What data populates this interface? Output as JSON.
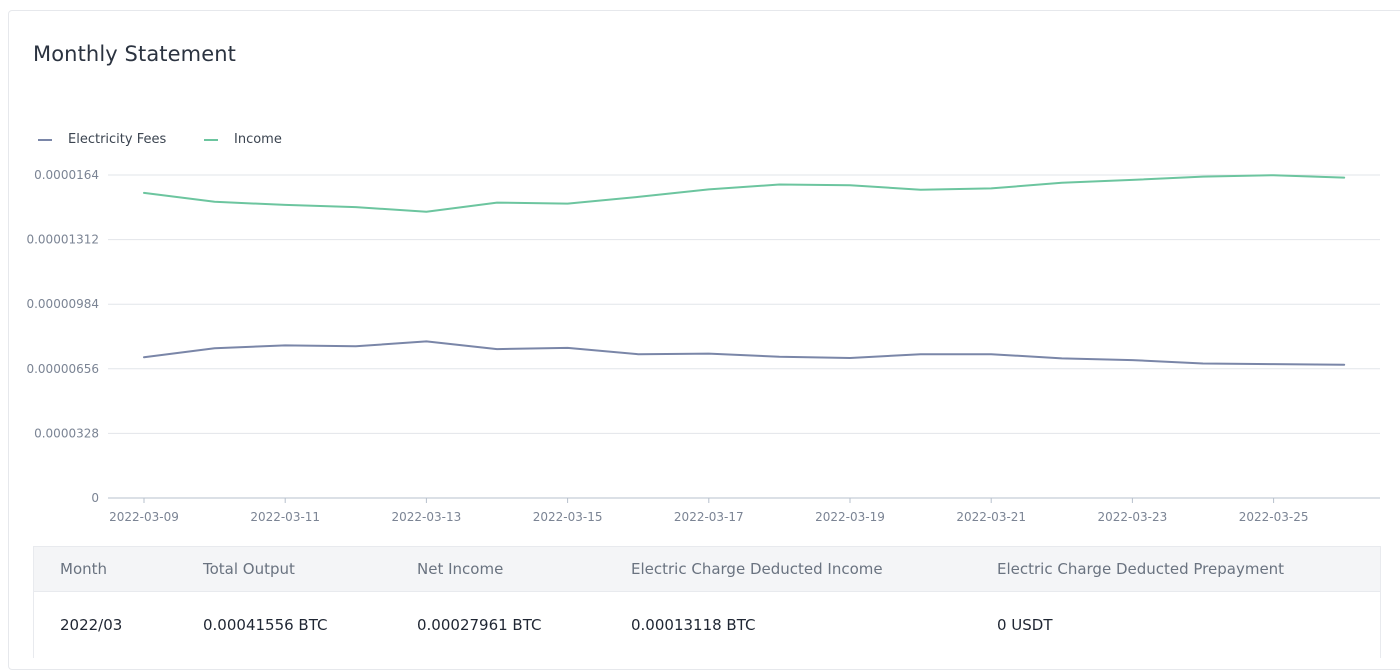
{
  "page": {
    "title": "Monthly Statement"
  },
  "colors": {
    "electricity": "#7a86a8",
    "income": "#6cc59f",
    "grid": "#e2e5ea",
    "axis": "#b7c0cc",
    "tick_text": "#7b8494"
  },
  "chart_data": {
    "type": "line",
    "title": "",
    "xlabel": "",
    "ylabel": "",
    "legend_position": "top-left",
    "grid": true,
    "ylim": [
      0,
      1.64e-05
    ],
    "y_ticks": [
      "0",
      "0.0000328",
      "0.00000656",
      "0.00000984",
      "0.00001312",
      "0.0000164"
    ],
    "x": [
      "2022-03-09",
      "2022-03-10",
      "2022-03-11",
      "2022-03-12",
      "2022-03-13",
      "2022-03-14",
      "2022-03-15",
      "2022-03-16",
      "2022-03-17",
      "2022-03-18",
      "2022-03-19",
      "2022-03-20",
      "2022-03-21",
      "2022-03-22",
      "2022-03-23",
      "2022-03-24",
      "2022-03-25",
      "2022-03-26"
    ],
    "x_tick_labels": [
      "2022-03-09",
      "2022-03-11",
      "2022-03-13",
      "2022-03-15",
      "2022-03-17",
      "2022-03-19",
      "2022-03-21",
      "2022-03-23",
      "2022-03-25"
    ],
    "series": [
      {
        "name": "Electricity Fees",
        "values": [
          7.15e-06,
          7.6e-06,
          7.75e-06,
          7.7e-06,
          7.95e-06,
          7.56e-06,
          7.62e-06,
          7.3e-06,
          7.33e-06,
          7.17e-06,
          7.11e-06,
          7.3e-06,
          7.3e-06,
          7.09e-06,
          7e-06,
          6.83e-06,
          6.8e-06,
          6.77e-06
        ]
      },
      {
        "name": "Income",
        "values": [
          1.549e-05,
          1.504e-05,
          1.488e-05,
          1.477e-05,
          1.453e-05,
          1.5e-05,
          1.495e-05,
          1.529e-05,
          1.567e-05,
          1.592e-05,
          1.588e-05,
          1.565e-05,
          1.572e-05,
          1.601e-05,
          1.615e-05,
          1.632e-05,
          1.639e-05,
          1.627e-05
        ]
      }
    ]
  },
  "table": {
    "headers": [
      "Month",
      "Total Output",
      "Net Income",
      "Electric Charge Deducted Income",
      "Electric Charge Deducted Prepayment"
    ],
    "rows": [
      [
        "2022/03",
        "0.00041556 BTC",
        "0.00027961 BTC",
        "0.00013118 BTC",
        "0 USDT"
      ]
    ]
  }
}
